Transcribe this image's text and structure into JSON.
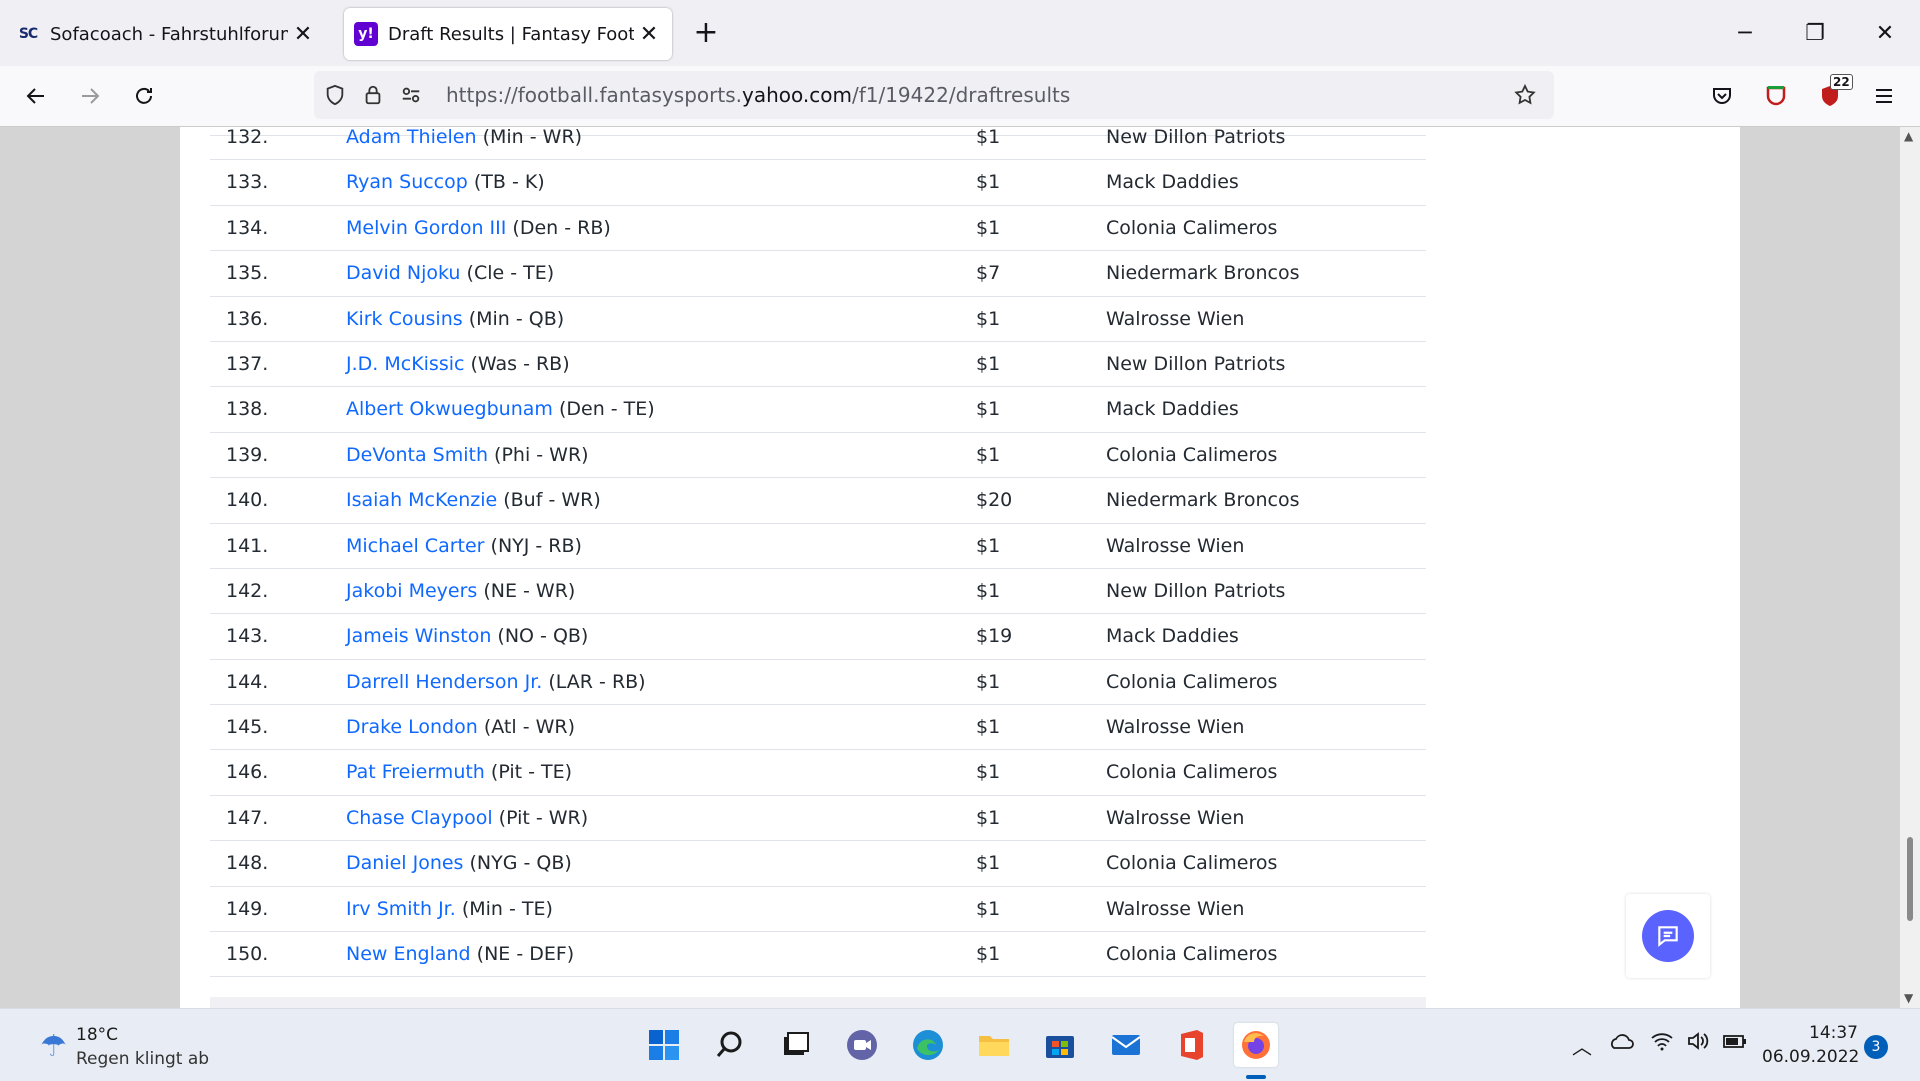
{
  "browser": {
    "tabs": [
      {
        "favicon": "SC",
        "title": "Sofacoach - Fahrstuhlforum",
        "active": false
      },
      {
        "favicon": "y!",
        "title": "Draft Results | Fantasy Football",
        "active": true
      }
    ],
    "url_prefix": "https://football.fantasysports.",
    "url_domain": "yahoo.com",
    "url_path": "/f1/19422/draftresults",
    "extension_badge": "22"
  },
  "draft_results": {
    "rows": [
      {
        "pick": "132.",
        "player": "Adam Thielen",
        "info": "(Min - WR)",
        "cost": "$1",
        "team": "New Dillon Patriots"
      },
      {
        "pick": "133.",
        "player": "Ryan Succop",
        "info": "(TB - K)",
        "cost": "$1",
        "team": "Mack Daddies"
      },
      {
        "pick": "134.",
        "player": "Melvin Gordon III",
        "info": "(Den - RB)",
        "cost": "$1",
        "team": "Colonia Calimeros"
      },
      {
        "pick": "135.",
        "player": "David Njoku",
        "info": "(Cle - TE)",
        "cost": "$7",
        "team": "Niedermark Broncos"
      },
      {
        "pick": "136.",
        "player": "Kirk Cousins",
        "info": "(Min - QB)",
        "cost": "$1",
        "team": "Walrosse Wien"
      },
      {
        "pick": "137.",
        "player": "J.D. McKissic",
        "info": "(Was - RB)",
        "cost": "$1",
        "team": "New Dillon Patriots"
      },
      {
        "pick": "138.",
        "player": "Albert Okwuegbunam",
        "info": "(Den - TE)",
        "cost": "$1",
        "team": "Mack Daddies"
      },
      {
        "pick": "139.",
        "player": "DeVonta Smith",
        "info": "(Phi - WR)",
        "cost": "$1",
        "team": "Colonia Calimeros"
      },
      {
        "pick": "140.",
        "player": "Isaiah McKenzie",
        "info": "(Buf - WR)",
        "cost": "$20",
        "team": "Niedermark Broncos"
      },
      {
        "pick": "141.",
        "player": "Michael Carter",
        "info": "(NYJ - RB)",
        "cost": "$1",
        "team": "Walrosse Wien"
      },
      {
        "pick": "142.",
        "player": "Jakobi Meyers",
        "info": "(NE - WR)",
        "cost": "$1",
        "team": "New Dillon Patriots"
      },
      {
        "pick": "143.",
        "player": "Jameis Winston",
        "info": "(NO - QB)",
        "cost": "$19",
        "team": "Mack Daddies"
      },
      {
        "pick": "144.",
        "player": "Darrell Henderson Jr.",
        "info": "(LAR - RB)",
        "cost": "$1",
        "team": "Colonia Calimeros"
      },
      {
        "pick": "145.",
        "player": "Drake London",
        "info": "(Atl - WR)",
        "cost": "$1",
        "team": "Walrosse Wien"
      },
      {
        "pick": "146.",
        "player": "Pat Freiermuth",
        "info": "(Pit - TE)",
        "cost": "$1",
        "team": "Colonia Calimeros"
      },
      {
        "pick": "147.",
        "player": "Chase Claypool",
        "info": "(Pit - WR)",
        "cost": "$1",
        "team": "Walrosse Wien"
      },
      {
        "pick": "148.",
        "player": "Daniel Jones",
        "info": "(NYG - QB)",
        "cost": "$1",
        "team": "Colonia Calimeros"
      },
      {
        "pick": "149.",
        "player": "Irv Smith Jr.",
        "info": "(Min - TE)",
        "cost": "$1",
        "team": "Walrosse Wien"
      },
      {
        "pick": "150.",
        "player": "New England",
        "info": "(NE - DEF)",
        "cost": "$1",
        "team": "Colonia Calimeros"
      }
    ]
  },
  "taskbar": {
    "weather_temp": "18°C",
    "weather_text": "Regen klingt ab",
    "time": "14:37",
    "date": "06.09.2022",
    "notifications": "3"
  }
}
